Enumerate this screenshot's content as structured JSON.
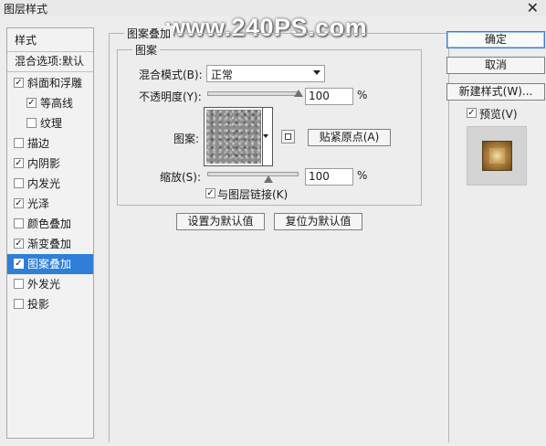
{
  "window": {
    "title": "图层样式",
    "close_glyph": "✕"
  },
  "watermark": "www.240PS.com",
  "style_list": {
    "header": "样式",
    "blend_options": "混合选项:默认",
    "items": [
      {
        "label": "斜面和浮雕",
        "checked": true,
        "indent": false
      },
      {
        "label": "等高线",
        "checked": true,
        "indent": true
      },
      {
        "label": "纹理",
        "checked": false,
        "indent": true
      },
      {
        "label": "描边",
        "checked": false,
        "indent": false
      },
      {
        "label": "内阴影",
        "checked": true,
        "indent": false
      },
      {
        "label": "内发光",
        "checked": false,
        "indent": false
      },
      {
        "label": "光泽",
        "checked": true,
        "indent": false
      },
      {
        "label": "颜色叠加",
        "checked": false,
        "indent": false
      },
      {
        "label": "渐变叠加",
        "checked": true,
        "indent": false
      },
      {
        "label": "图案叠加",
        "checked": true,
        "indent": false,
        "selected": true
      },
      {
        "label": "外发光",
        "checked": false,
        "indent": false
      },
      {
        "label": "投影",
        "checked": false,
        "indent": false
      }
    ]
  },
  "panel": {
    "outer_title": "图案叠加",
    "inner_title": "图案",
    "blend_mode_label": "混合模式(B):",
    "blend_mode_value": "正常",
    "opacity_label": "不透明度(Y):",
    "opacity_value": "100",
    "opacity_percent": 100,
    "percent_sign": "%",
    "pattern_label": "图案:",
    "snap_origin_button": "贴紧原点(A)",
    "scale_label": "缩放(S):",
    "scale_value": "100",
    "scale_percent": 100,
    "link_with_layer_label": "与图层链接(K)",
    "link_with_layer_checked": true,
    "make_default_button": "设置为默认值",
    "reset_default_button": "复位为默认值"
  },
  "right_buttons": {
    "ok": "确定",
    "cancel": "取消",
    "new_style": "新建样式(W)...",
    "preview_label": "预览(V)",
    "preview_checked": true
  },
  "colors": {
    "selection": "#2f7fd8",
    "default_button_border": "#3a7bd5"
  }
}
